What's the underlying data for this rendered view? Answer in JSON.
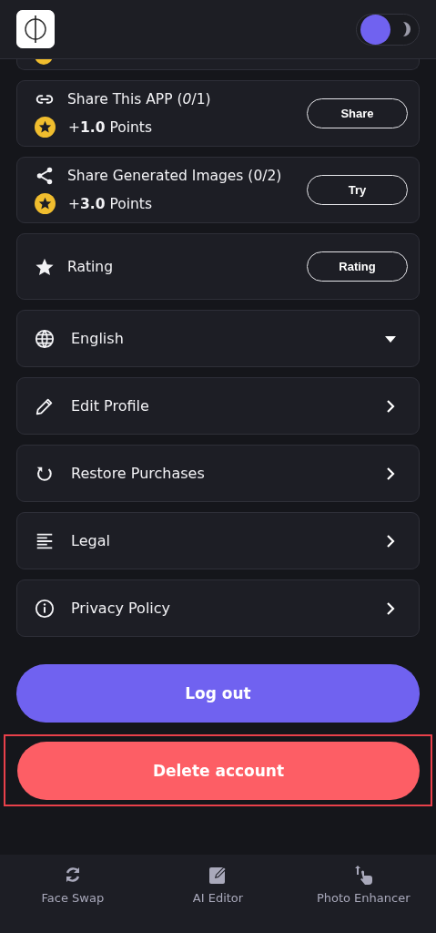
{
  "header": {
    "dark_mode": false
  },
  "rewards": [
    {
      "title": "Share This APP (*0*/1)",
      "points": "+**1.0** Points",
      "button": "Share"
    },
    {
      "title": "Share Generated Images (0/2)",
      "points": "+**3.0** Points",
      "button": "Try"
    },
    {
      "title": "Rating",
      "button": "Rating"
    }
  ],
  "menu": [
    {
      "label": "English",
      "kind": "dropdown"
    },
    {
      "label": "Edit Profile",
      "kind": "link"
    },
    {
      "label": "Restore Purchases",
      "kind": "link"
    },
    {
      "label": "Legal",
      "kind": "link"
    },
    {
      "label": "Privacy Policy",
      "kind": "link"
    }
  ],
  "buttons": [
    {
      "label": "Log out",
      "kind": "primary",
      "highlighted": false
    },
    {
      "label": "Delete account",
      "kind": "danger",
      "highlighted": true
    }
  ],
  "bottom_nav": [
    {
      "label": "Face Swap"
    },
    {
      "label": "AI Editor"
    },
    {
      "label": "Photo Enhancer"
    }
  ]
}
